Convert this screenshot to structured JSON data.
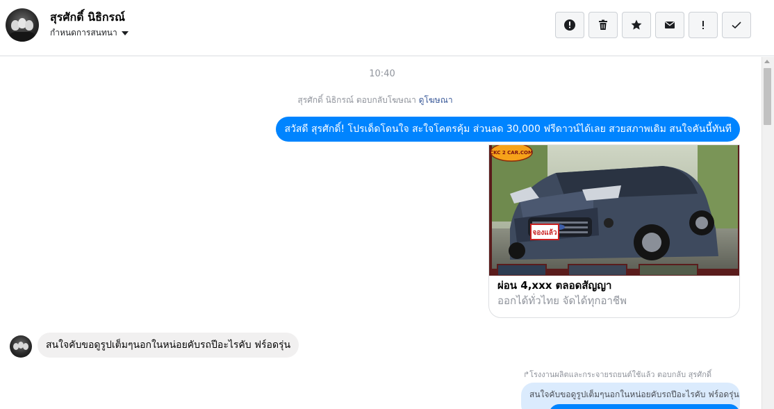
{
  "header": {
    "contact_name": "สุรศักดิ์ นิธิกรณ์",
    "subtitle": "กำหนดการสนทนา",
    "actions": [
      {
        "name": "report-button",
        "icon": "alert-circle-icon"
      },
      {
        "name": "delete-button",
        "icon": "trash-icon"
      },
      {
        "name": "star-button",
        "icon": "star-icon"
      },
      {
        "name": "mark-unread-button",
        "icon": "envelope-icon"
      },
      {
        "name": "spam-button",
        "icon": "exclamation-icon"
      },
      {
        "name": "done-button",
        "icon": "check-icon"
      }
    ]
  },
  "conversation": {
    "timestamp": "10:40",
    "reply_note": {
      "text": "สุรศักดิ์ นิธิกรณ์ ตอบกลับโฆษณา",
      "link": "ดูโฆษณา"
    },
    "outgoing_message": "สวัสดี สุรศักดิ์! โปรเด็ดโดนใจ สะใจโคตรคุ้ม ส่วนลด 30,000 ฟรีดาวน์ได้เลย สวยสภาพเดิม สนใจคันนี้ทันที",
    "ad_card": {
      "badge": "CKC 2 CAR.COM",
      "sticker": "จองแล้ว",
      "title": "ผ่อน 4,xxx ตลอดสัญญา",
      "subtitle": "ออกได้ทั่วไทย จัดได้ทุกอาชีพ"
    },
    "incoming_message": "สนใจคับขอดูรูปเต็มๆนอกในหน่อยคับรถปีอะไรคับ ฟร์อดรุ่น",
    "replied_to_label": "↱โรงงานผลิตและกระจายรถยนต์ใช้แล้ว ตอบกลับ สุรศักดิ์",
    "quoted_message": "สนใจคับขอดูรูปเต็มๆนอกในหน่อยคับรถปีอะไรคับ ฟร์อดรุ่น"
  },
  "colors": {
    "accent": "#0084ff",
    "incoming_bubble": "#f1f0f0",
    "quote_bubble": "#dbebfd",
    "meta_text": "#90949c",
    "link": "#385898"
  }
}
